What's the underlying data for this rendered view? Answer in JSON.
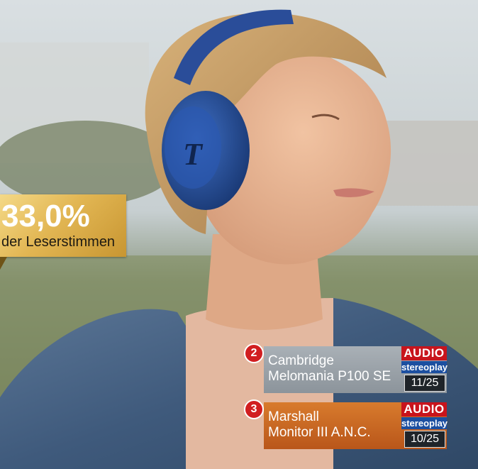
{
  "vote": {
    "percent": "33,0%",
    "label": "der Leserstimmen"
  },
  "ranking": [
    {
      "rank": "2",
      "name_line1": "Cambridge",
      "name_line2": "Melomania P100 SE",
      "mag_top": "AUDIO",
      "mag_bottom": "stereoplay",
      "issue": "11/25"
    },
    {
      "rank": "3",
      "name_line1": "Marshall",
      "name_line2": "Monitor III A.N.C.",
      "mag_top": "AUDIO",
      "mag_bottom": "stereoplay",
      "issue": "10/25"
    }
  ],
  "colors": {
    "gold": "#e2b653",
    "silver": "#9aa2a8",
    "bronze": "#c8662a",
    "audio_red": "#c8141c",
    "stereo_blue": "#1c4fa0"
  }
}
